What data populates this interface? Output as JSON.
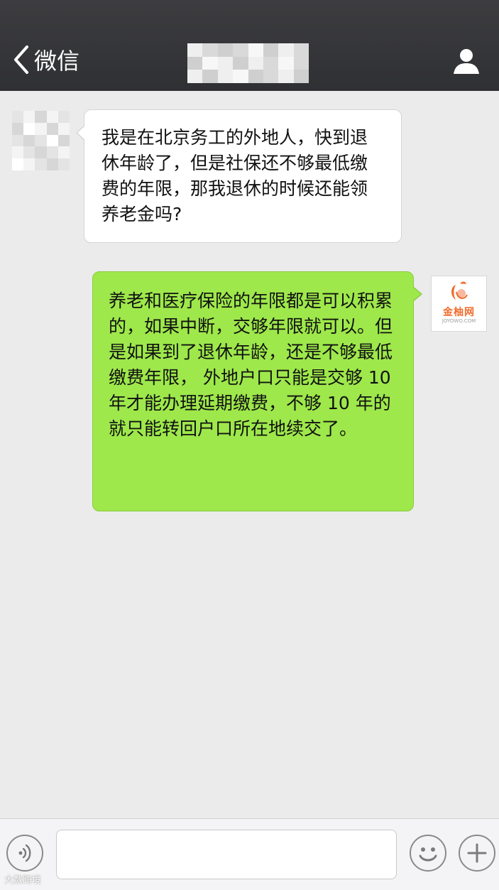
{
  "header": {
    "back_label": "微信"
  },
  "messages": [
    {
      "side": "left",
      "text": "我是在北京务工的外地人，快到退休年龄了，但是社保还不够最低缴费的年限，那我退休的时候还能领养老金吗?"
    },
    {
      "side": "right",
      "text": "养老和医疗保险的年限都是可以积累的，如果中断，交够年限就可以。但是如果到了退休年龄，还是不够最低缴费年限， 外地户口只能是交够 10 年才能办理延期缴费，不够 10 年的就只能转回户口所在地续交了。"
    }
  ],
  "right_avatar": {
    "logo_text": "金柚网",
    "logo_sub": "JOYOWO.COM"
  },
  "input": {
    "value": "",
    "placeholder": ""
  },
  "watermark": {
    "text": "大数跨境"
  },
  "colors": {
    "header": "#333438",
    "chat_background": "#ebebeb",
    "incoming_bubble": "#ffffff",
    "outgoing_bubble": "#9ee84b",
    "brand_orange": "#f06b2b"
  }
}
